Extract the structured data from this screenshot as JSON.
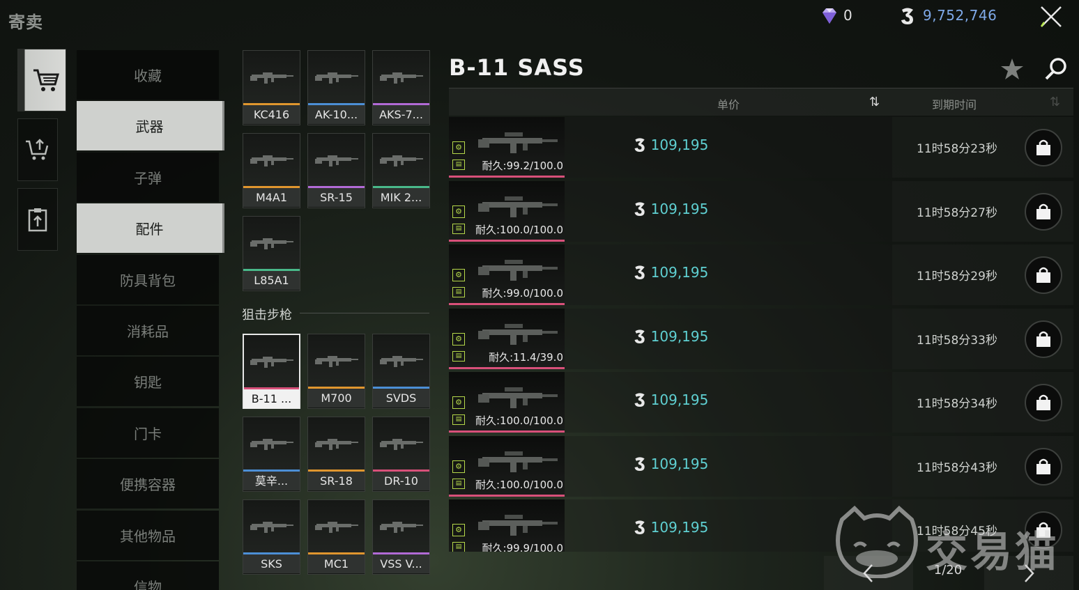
{
  "header": {
    "title": "寄卖",
    "gem_count": "0",
    "coin_total": "9,752,746"
  },
  "rail": [
    {
      "icon": "shopping-cart-icon",
      "active": true
    },
    {
      "icon": "sell-cart-icon",
      "active": false
    },
    {
      "icon": "clipboard-upload-icon",
      "active": false
    }
  ],
  "categories": [
    {
      "label": "收藏",
      "active": false
    },
    {
      "label": "武器",
      "active": true
    },
    {
      "label": "子弹",
      "active": false
    },
    {
      "label": "配件",
      "active": true
    },
    {
      "label": "防具背包",
      "active": false
    },
    {
      "label": "消耗品",
      "active": false
    },
    {
      "label": "钥匙",
      "active": false
    },
    {
      "label": "门卡",
      "active": false
    },
    {
      "label": "便携容器",
      "active": false
    },
    {
      "label": "其他物品",
      "active": false
    },
    {
      "label": "信物",
      "active": false
    }
  ],
  "rifles": [
    {
      "label": "KC416",
      "rarity_color": "#e0962e"
    },
    {
      "label": "AK-10...",
      "rarity_color": "#4c8fd6"
    },
    {
      "label": "AKS-7...",
      "rarity_color": "#b26ad6"
    },
    {
      "label": "M4A1",
      "rarity_color": "#e0962e"
    },
    {
      "label": "SR-15",
      "rarity_color": "#b26ad6"
    },
    {
      "label": "MIK 2...",
      "rarity_color": "#49b98a"
    },
    {
      "label": "L85A1",
      "rarity_color": "#49b98a"
    }
  ],
  "sniper_section_label": "狙击步枪",
  "snipers": [
    {
      "label": "B-11 ...",
      "rarity_color": "#d8507a",
      "selected": true
    },
    {
      "label": "M700",
      "rarity_color": "#e0962e"
    },
    {
      "label": "SVDS",
      "rarity_color": "#4c8fd6"
    },
    {
      "label": "莫辛...",
      "rarity_color": "#4c8fd6"
    },
    {
      "label": "SR-18",
      "rarity_color": "#e0962e"
    },
    {
      "label": "DR-10",
      "rarity_color": "#d8507a"
    },
    {
      "label": "SKS",
      "rarity_color": "#4c8fd6"
    },
    {
      "label": "MC1",
      "rarity_color": "#e0962e"
    },
    {
      "label": "VSS V...",
      "rarity_color": "#b26ad6"
    }
  ],
  "detail": {
    "item_name": "B-11 SASS",
    "col_price": "单价",
    "col_expire": "到期时间",
    "listings": [
      {
        "durability": "耐久:99.2/100.0",
        "price": "109,195",
        "expire": "11时58分23秒"
      },
      {
        "durability": "耐久:100.0/100.0",
        "price": "109,195",
        "expire": "11时58分27秒"
      },
      {
        "durability": "耐久:99.0/100.0",
        "price": "109,195",
        "expire": "11时58分29秒"
      },
      {
        "durability": "耐久:11.4/39.0",
        "price": "109,195",
        "expire": "11时58分33秒"
      },
      {
        "durability": "耐久:100.0/100.0",
        "price": "109,195",
        "expire": "11时58分34秒"
      },
      {
        "durability": "耐久:100.0/100.0",
        "price": "109,195",
        "expire": "11时58分43秒"
      },
      {
        "durability": "耐久:99.9/100.0",
        "price": "109,195",
        "expire": "11时58分45秒"
      }
    ]
  },
  "pager": {
    "text": "1/20"
  },
  "watermark": {
    "text": "交易猫"
  },
  "colors": {
    "price": "#5fd0d2",
    "coin_total": "#7fa9e8",
    "rarity_gold": "#e0962e",
    "rarity_blue": "#4c8fd6",
    "rarity_purple": "#b26ad6",
    "rarity_green": "#49b98a",
    "rarity_red": "#d8507a"
  }
}
